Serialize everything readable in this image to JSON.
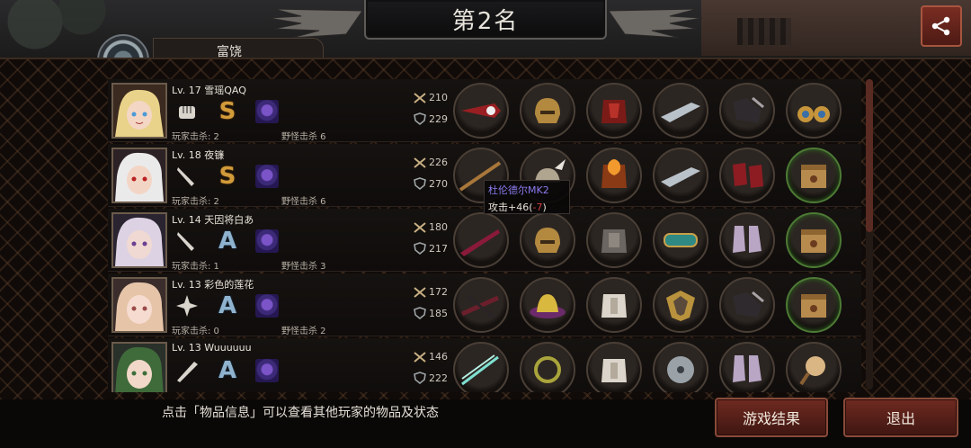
{
  "header": {
    "title": "第2名",
    "share_icon": "share-icon",
    "profile_label": "富饶"
  },
  "players": [
    {
      "level_name": "Lv. 17 雪瑶QAQ",
      "weapon_icon": "fist-icon",
      "grade": "S",
      "kills": "玩家击杀: 2",
      "monsters": "野怪击杀 6",
      "attack": "210",
      "defense": "229",
      "items": [
        "red-sword-item",
        "gold-helmet-item",
        "red-armor-item",
        "silver-gauntlet-item",
        "dark-boots-item",
        "gold-earring-item"
      ]
    },
    {
      "level_name": "Lv. 18 夜镰",
      "weapon_icon": "knife-icon",
      "grade": "S",
      "kills": "玩家击杀: 2",
      "monsters": "野怪击杀 6",
      "attack": "226",
      "defense": "270",
      "items": [
        "spear-item",
        "wing-helmet-item",
        "flame-armor-item",
        "silver-gauntlet-item",
        "red-heels-item",
        "supply-box-item"
      ]
    },
    {
      "level_name": "Lv. 14 天因将白あ",
      "weapon_icon": "knife-icon",
      "grade": "A",
      "kills": "玩家击杀: 1",
      "monsters": "野怪击杀 3",
      "attack": "180",
      "defense": "217",
      "items": [
        "crimson-blade-item",
        "gold-helmet-item",
        "plate-armor-item",
        "jade-bracer-item",
        "purple-boots-item",
        "supply-box-item"
      ]
    },
    {
      "level_name": "Lv. 13 彩色的莲花",
      "weapon_icon": "shuriken-icon",
      "grade": "A",
      "kills": "玩家击杀: 0",
      "monsters": "野怪击杀 2",
      "attack": "172",
      "defense": "185",
      "items": [
        "crossbow-item",
        "purple-hat-item",
        "white-armor-item",
        "shield-item",
        "dark-boots-item",
        "supply-box-item"
      ]
    },
    {
      "level_name": "Lv. 13 Wuuuuuu",
      "weapon_icon": "bat-icon",
      "grade": "A",
      "kills": "",
      "monsters": "",
      "attack": "146",
      "defense": "222",
      "items": [
        "twin-blade-item",
        "laurel-item",
        "white-armor-item",
        "disc-item",
        "purple-boots-item",
        "paddle-item"
      ]
    }
  ],
  "tooltip": {
    "name": "杜伦德尔MK2",
    "stat_prefix": "攻击+46(",
    "stat_neg": "-7",
    "stat_suffix": ")"
  },
  "footer": {
    "hint": "点击「物品信息」可以查看其他玩家的物品及状态",
    "result_button": "游戏结果",
    "exit_button": "退出"
  },
  "colors": {
    "accent_red": "#6e2a20",
    "grade_s": "#d29b3a",
    "grade_a": "#8fb3cf",
    "tooltip_name": "#8b7cf0",
    "negative": "#d04040"
  }
}
